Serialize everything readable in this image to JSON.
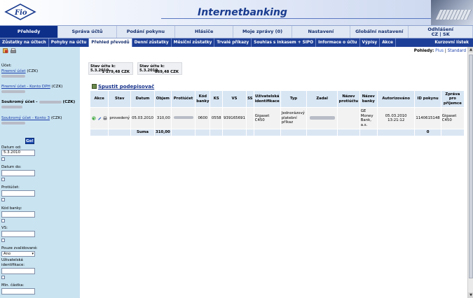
{
  "header": {
    "title": "Internetbanking"
  },
  "mainnav": [
    {
      "label": "Přehledy",
      "active": true
    },
    {
      "label": "Správa účtů"
    },
    {
      "label": "Podání pokynu"
    },
    {
      "label": "Hlásiče"
    },
    {
      "label": "Moje zprávy (0)"
    },
    {
      "label": "Nastavení"
    },
    {
      "label": "Globální nastavení"
    }
  ],
  "logout": {
    "label": "Odhlášení",
    "langs": "CZ | SK"
  },
  "subnav": [
    {
      "label": "Zůstatky na účtech"
    },
    {
      "label": "Pohyby na účtu"
    },
    {
      "label": "Přehled převodů",
      "active": true
    },
    {
      "label": "Denní zůstatky"
    },
    {
      "label": "Měsíční zůstatky"
    },
    {
      "label": "Trvalé příkazy"
    },
    {
      "label": "Souhlas s inkasem + SIPO"
    },
    {
      "label": "Informace o účtu"
    },
    {
      "label": "Výpisy"
    },
    {
      "label": "Akce"
    }
  ],
  "subnav_right": "Kurzovní lístek",
  "sidebar": {
    "ucet_label": "Účet:",
    "accounts": [
      {
        "link": "Firemní účet",
        "suffix": " (CZK)"
      },
      {
        "link": "Firemní účet - Konto DPH",
        "suffix": " (CZK)"
      },
      {
        "prefix": "Soukromý účet - ",
        "suffix": " (CZK)"
      },
      {
        "link": "Soukromý účet - Konto 3",
        "suffix": " (CZK)"
      }
    ],
    "go_label": "Go!",
    "filters": {
      "datum_od_label": "Datum od:",
      "datum_od_value": "5.3.2010",
      "datum_do_label": "Datum do:",
      "protiucet_label": "Protiúčet:",
      "kod_banky_label": "Kód banky:",
      "vs_label": "VS:",
      "pouze_label": "Pouze zvalidované:",
      "pouze_value": "Ano",
      "uziv_label": "Uživatelská identifikace:",
      "min_castka_label": "Min. částka:"
    }
  },
  "pohledy": {
    "label": "Pohledy:",
    "plus": "Plus",
    "separator": "|",
    "standard": "Standard"
  },
  "state_boxes": [
    {
      "label": "Stav účtu k: 5.3.2010",
      "value": "1 179,48 CZK"
    },
    {
      "label": "Stav účtu k: 5.3.2010",
      "value": "869,48 CZK"
    }
  ],
  "podepis_label": "Spustit podepisovač",
  "table": {
    "headers": [
      "Akce",
      "Stav",
      "Datum",
      "Objem",
      "Protiúčet",
      "Kód banky",
      "KS",
      "VS",
      "SS",
      "Uživatelská identifikace",
      "Typ",
      "Zadal",
      "Název protiúčtu",
      "Název banky",
      "Autorizováno",
      "ID pokynu",
      "Zpráva pro příjemce"
    ],
    "row": {
      "stav": "provedený",
      "datum": "05.03.2010",
      "objem": "310,00",
      "kod_banky": "0600",
      "ks": "0558",
      "vs": "939165691",
      "ss": "",
      "uziv": "Gigaset C450",
      "typ": "Jednorázový platební příkaz",
      "nazev_protiuctu": "",
      "nazev_banky": "GE Money Bank, a.s.",
      "autorizovano": "05.03.2010 13:21:12",
      "id_pokynu": "1140615148",
      "zprava": "Gigaset C450"
    },
    "sum_label": "Suma",
    "sum_value": "310,00",
    "sum_id": "0"
  }
}
